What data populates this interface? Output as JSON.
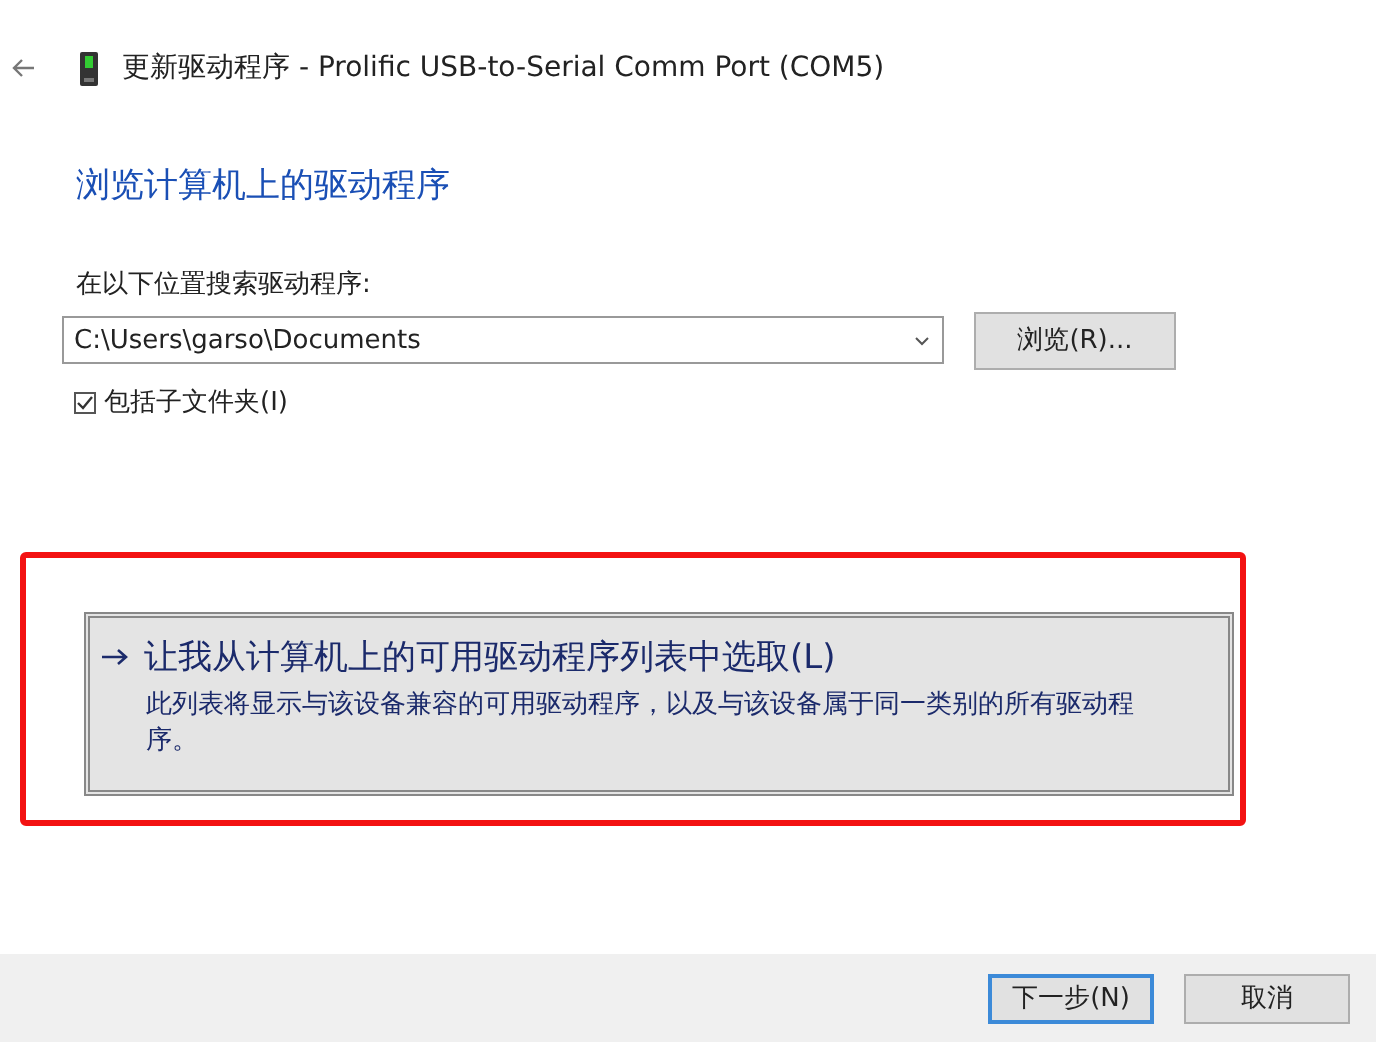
{
  "window": {
    "title": "更新驱动程序 - Prolific USB-to-Serial Comm Port (COM5)"
  },
  "heading": "浏览计算机上的驱动程序",
  "search": {
    "label": "在以下位置搜索驱动程序:",
    "value": "C:\\Users\\garso\\Documents",
    "browse_button": "浏览(R)..."
  },
  "include_subfolders": {
    "label": "包括子文件夹(I)",
    "checked": true
  },
  "pick_option": {
    "title": "让我从计算机上的可用驱动程序列表中选取(L)",
    "description": "此列表将显示与该设备兼容的可用驱动程序，以及与该设备属于同一类别的所有驱动程序。",
    "highlight": {
      "kind": "rectangle"
    }
  },
  "buttons": [
    {
      "label": "下一步(N)",
      "default": true
    },
    {
      "label": "取消",
      "default": false
    }
  ]
}
